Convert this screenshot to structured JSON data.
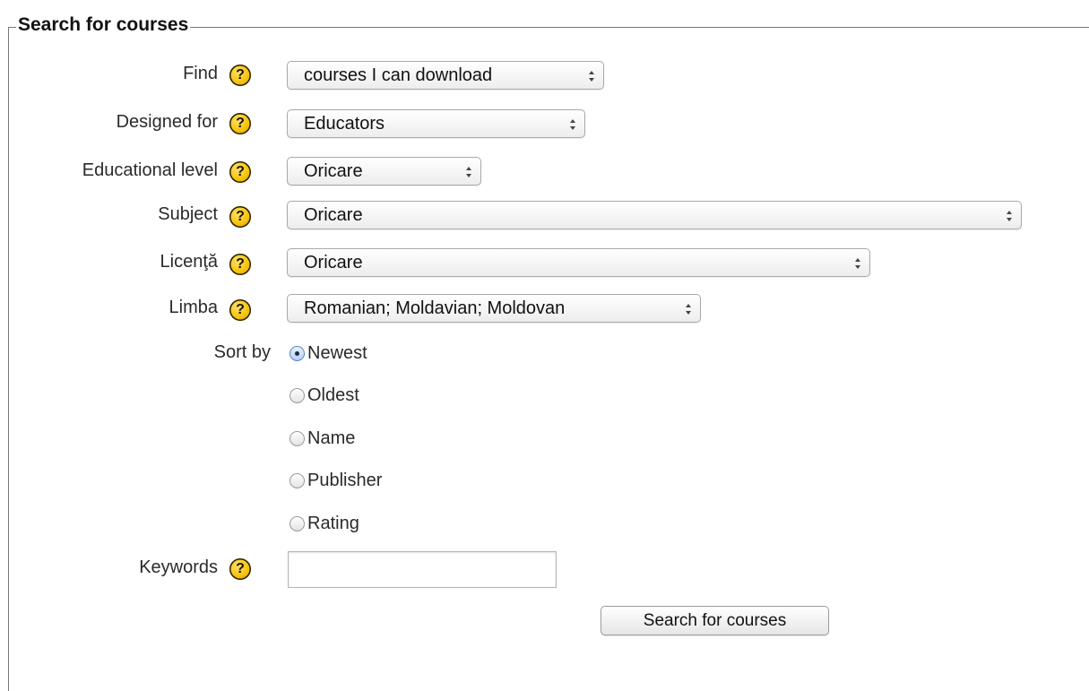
{
  "form": {
    "legend": "Search for courses",
    "help_icon_glyph": "?",
    "help_icon_color": "#f5c20a",
    "fields": {
      "find": {
        "label": "Find",
        "value": "courses I can download"
      },
      "designed_for": {
        "label": "Designed for",
        "value": "Educators"
      },
      "educational_level": {
        "label": "Educational level",
        "value": "Oricare"
      },
      "subject": {
        "label": "Subject",
        "value": "Oricare"
      },
      "licence": {
        "label": "Licenţă",
        "value": "Oricare"
      },
      "language": {
        "label": "Limba",
        "value": "Romanian; Moldavian; Moldovan"
      }
    },
    "sort": {
      "label": "Sort by",
      "options": [
        "Newest",
        "Oldest",
        "Name",
        "Publisher",
        "Rating"
      ],
      "selected": "Newest"
    },
    "keywords": {
      "label": "Keywords",
      "value": "",
      "placeholder": ""
    },
    "submit_label": "Search for courses"
  }
}
